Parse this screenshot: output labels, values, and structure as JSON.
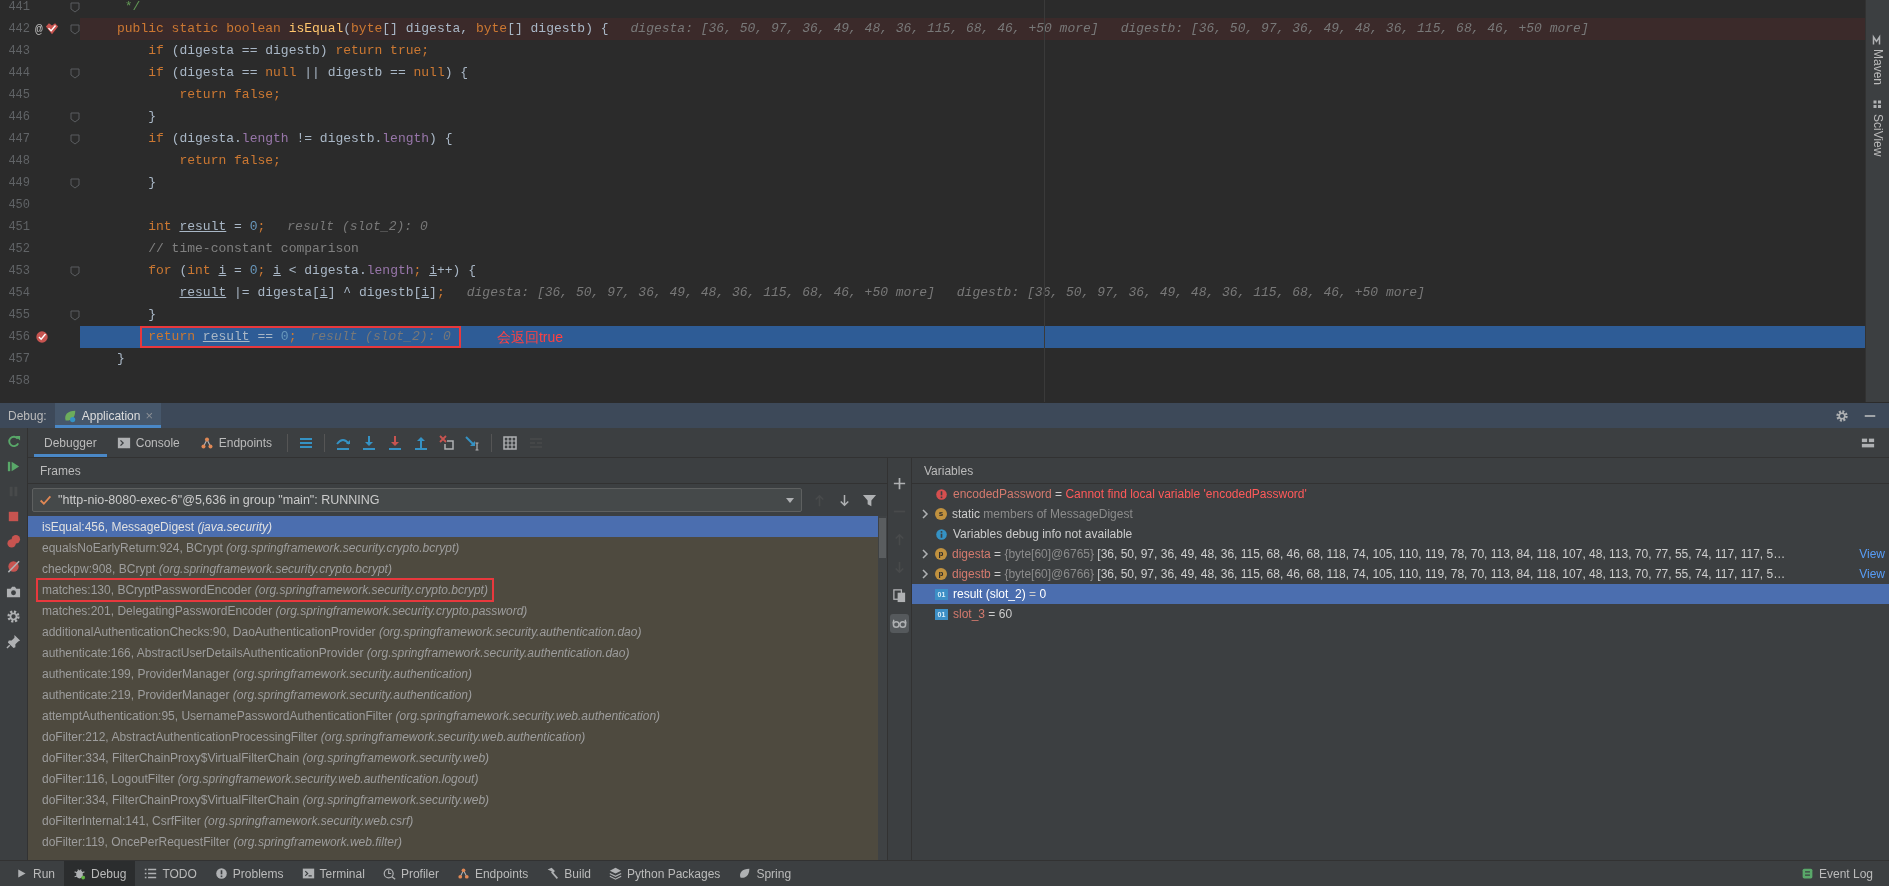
{
  "editor": {
    "lines": [
      {
        "kind": "code",
        "number": "441",
        "fold": true,
        "tokens": [
          {
            "kind": "doc",
            "text": " */"
          }
        ]
      },
      {
        "kind": "breakpoint",
        "number": "442",
        "gutter_symbol": "@",
        "fold": true,
        "tokens": [
          {
            "kind": "kw",
            "text": "public static boolean "
          },
          {
            "kind": "fn",
            "text": "isEqual"
          },
          {
            "kind": "plain",
            "text": "("
          },
          {
            "kind": "kw",
            "text": "byte"
          },
          {
            "kind": "plain",
            "text": "[] digesta, "
          },
          {
            "kind": "kw",
            "text": "byte"
          },
          {
            "kind": "plain",
            "text": "[] digestb) {"
          }
        ],
        "hints": [
          "digesta: [36, 50, 97, 36, 49, 48, 36, 115, 68, 46, +50 more]",
          "digestb: [36, 50, 97, 36, 49, 48, 36, 115, 68, 46, +50 more]"
        ]
      },
      {
        "kind": "code",
        "number": "443",
        "fold": false,
        "tokens": [
          {
            "kind": "kw",
            "text": "    if"
          },
          {
            "kind": "plain",
            "text": " (digesta == digestb) "
          },
          {
            "kind": "kw",
            "text": "return true;"
          }
        ]
      },
      {
        "kind": "code",
        "number": "444",
        "fold": true,
        "tokens": [
          {
            "kind": "kw",
            "text": "    if"
          },
          {
            "kind": "plain",
            "text": " (digesta == "
          },
          {
            "kind": "kw",
            "text": "null"
          },
          {
            "kind": "plain",
            "text": " || digestb == "
          },
          {
            "kind": "kw",
            "text": "null"
          },
          {
            "kind": "plain",
            "text": ") {"
          }
        ]
      },
      {
        "kind": "code",
        "number": "445",
        "fold": false,
        "tokens": [
          {
            "kind": "kw",
            "text": "        return false;"
          }
        ]
      },
      {
        "kind": "code",
        "number": "446",
        "fold": true,
        "tokens": [
          {
            "kind": "plain",
            "text": "    }"
          }
        ]
      },
      {
        "kind": "code",
        "number": "447",
        "fold": true,
        "tokens": [
          {
            "kind": "kw",
            "text": "    if"
          },
          {
            "kind": "plain",
            "text": " (digesta."
          },
          {
            "kind": "field",
            "text": "length"
          },
          {
            "kind": "plain",
            "text": " != digestb."
          },
          {
            "kind": "field",
            "text": "length"
          },
          {
            "kind": "plain",
            "text": ") {"
          }
        ]
      },
      {
        "kind": "code",
        "number": "448",
        "fold": false,
        "tokens": [
          {
            "kind": "kw",
            "text": "        return false;"
          }
        ]
      },
      {
        "kind": "code",
        "number": "449",
        "fold": true,
        "tokens": [
          {
            "kind": "plain",
            "text": "    }"
          }
        ]
      },
      {
        "kind": "code",
        "number": "450",
        "fold": false
      },
      {
        "kind": "code",
        "number": "451",
        "fold": false,
        "tokens": [
          {
            "kind": "kw",
            "text": "    int "
          },
          {
            "kind": "var",
            "text": "result"
          },
          {
            "kind": "plain",
            "text": " = "
          },
          {
            "kind": "num",
            "text": "0"
          },
          {
            "kind": "kw",
            "text": ";"
          }
        ],
        "hints": [
          "result (slot_2): 0"
        ]
      },
      {
        "kind": "code",
        "number": "452",
        "fold": false,
        "tokens": [
          {
            "kind": "comment",
            "text": "    // time-constant comparison"
          }
        ]
      },
      {
        "kind": "code",
        "number": "453",
        "fold": true,
        "tokens": [
          {
            "kind": "kw",
            "text": "    for"
          },
          {
            "kind": "plain",
            "text": " ("
          },
          {
            "kind": "kw",
            "text": "int "
          },
          {
            "kind": "var",
            "text": "i"
          },
          {
            "kind": "plain",
            "text": " = "
          },
          {
            "kind": "num",
            "text": "0"
          },
          {
            "kind": "kw",
            "text": "; "
          },
          {
            "kind": "var",
            "text": "i"
          },
          {
            "kind": "plain",
            "text": " < digesta."
          },
          {
            "kind": "field",
            "text": "length"
          },
          {
            "kind": "kw",
            "text": "; "
          },
          {
            "kind": "var",
            "text": "i"
          },
          {
            "kind": "plain",
            "text": "++) {"
          }
        ]
      },
      {
        "kind": "code",
        "number": "454",
        "fold": false,
        "tokens": [
          {
            "kind": "var",
            "text": "        result"
          },
          {
            "kind": "plain",
            "text": " |= digesta["
          },
          {
            "kind": "var",
            "text": "i"
          },
          {
            "kind": "plain",
            "text": "] ^ digestb["
          },
          {
            "kind": "var",
            "text": "i"
          },
          {
            "kind": "plain",
            "text": "]"
          },
          {
            "kind": "kw",
            "text": ";"
          }
        ],
        "hints": [
          "digesta: [36, 50, 97, 36, 49, 48, 36, 115, 68, 46, +50 more]",
          "digestb: [36, 50, 97, 36, 49, 48, 36, 115, 68, 46, +50 more]"
        ]
      },
      {
        "kind": "code",
        "number": "455",
        "fold": true,
        "tokens": [
          {
            "kind": "plain",
            "text": "    }"
          }
        ]
      },
      {
        "kind": "execution",
        "number": "456",
        "fold": false,
        "boxed": true,
        "tokens": [
          {
            "kind": "kw",
            "text": "    return "
          },
          {
            "kind": "var",
            "text": "result"
          },
          {
            "kind": "plain",
            "text": " == "
          },
          {
            "kind": "num",
            "text": "0"
          },
          {
            "kind": "kw",
            "text": ";"
          }
        ],
        "hints": [
          "result (slot_2): 0"
        ],
        "note": "会返回true"
      },
      {
        "kind": "code",
        "number": "457",
        "fold": false,
        "tokens": [
          {
            "kind": "plain",
            "text": "}"
          }
        ]
      },
      {
        "kind": "code",
        "number": "458",
        "fold": false
      }
    ]
  },
  "right_stripe": [
    {
      "kind": "maven",
      "label": "Maven"
    },
    {
      "kind": "sciview",
      "label": "SciView"
    }
  ],
  "debug": {
    "label": "Debug:",
    "sessions": [
      {
        "label": "Application",
        "close": "×",
        "selected": true
      }
    ],
    "tabs": [
      {
        "kind": "debugger",
        "label": "Debugger",
        "selected": true
      },
      {
        "kind": "console",
        "label": "Console",
        "selected": false
      },
      {
        "kind": "endpoints",
        "label": "Endpoints",
        "selected": false
      }
    ],
    "toolbar": [
      {
        "kind": "menu",
        "disabled": false
      },
      {
        "kind": "stepover",
        "disabled": false
      },
      {
        "kind": "stepinto",
        "disabled": false
      },
      {
        "kind": "forcestepinto",
        "disabled": false
      },
      {
        "kind": "stepout",
        "disabled": false
      },
      {
        "kind": "dropframe",
        "disabled": false
      },
      {
        "kind": "runtocursor",
        "disabled": false
      },
      {
        "kind": "evaluate",
        "disabled": false
      },
      {
        "kind": "trace",
        "disabled": true
      }
    ],
    "side_toolbar": [
      {
        "kind": "rerun",
        "disabled": false
      },
      {
        "kind": "resume",
        "disabled": false
      },
      {
        "kind": "pause",
        "disabled": true
      },
      {
        "kind": "stop",
        "disabled": false
      },
      {
        "kind": "breakpoints",
        "disabled": false
      },
      {
        "kind": "mute",
        "disabled": false
      },
      {
        "kind": "camera",
        "disabled": false
      },
      {
        "kind": "settings",
        "disabled": false
      },
      {
        "kind": "pin",
        "disabled": false
      }
    ],
    "frames": {
      "title": "Frames",
      "thread": "\"http-nio-8080-exec-6\"@5,636 in group \"main\": RUNNING",
      "nav": [
        {
          "kind": "up",
          "disabled": true
        },
        {
          "kind": "down",
          "disabled": false
        },
        {
          "kind": "filter",
          "disabled": false
        }
      ],
      "items": [
        {
          "method": "isEqual:456, MessageDigest",
          "package": "(java.security)",
          "selected": true,
          "boxed": false
        },
        {
          "method": "equalsNoEarlyReturn:924, BCrypt",
          "package": "(org.springframework.security.crypto.bcrypt)",
          "selected": false,
          "boxed": false
        },
        {
          "method": "checkpw:908, BCrypt",
          "package": "(org.springframework.security.crypto.bcrypt)",
          "selected": false,
          "boxed": false
        },
        {
          "method": "matches:130, BCryptPasswordEncoder",
          "package": "(org.springframework.security.crypto.bcrypt)",
          "selected": false,
          "boxed": true
        },
        {
          "method": "matches:201, DelegatingPasswordEncoder",
          "package": "(org.springframework.security.crypto.password)",
          "selected": false,
          "boxed": false
        },
        {
          "method": "additionalAuthenticationChecks:90, DaoAuthenticationProvider",
          "package": "(org.springframework.security.authentication.dao)",
          "selected": false,
          "boxed": false
        },
        {
          "method": "authenticate:166, AbstractUserDetailsAuthenticationProvider",
          "package": "(org.springframework.security.authentication.dao)",
          "selected": false,
          "boxed": false
        },
        {
          "method": "authenticate:199, ProviderManager",
          "package": "(org.springframework.security.authentication)",
          "selected": false,
          "boxed": false
        },
        {
          "method": "authenticate:219, ProviderManager",
          "package": "(org.springframework.security.authentication)",
          "selected": false,
          "boxed": false
        },
        {
          "method": "attemptAuthentication:95, UsernamePasswordAuthenticationFilter",
          "package": "(org.springframework.security.web.authentication)",
          "selected": false,
          "boxed": false
        },
        {
          "method": "doFilter:212, AbstractAuthenticationProcessingFilter",
          "package": "(org.springframework.security.web.authentication)",
          "selected": false,
          "boxed": false
        },
        {
          "method": "doFilter:334, FilterChainProxy$VirtualFilterChain",
          "package": "(org.springframework.security.web)",
          "selected": false,
          "boxed": false
        },
        {
          "method": "doFilter:116, LogoutFilter",
          "package": "(org.springframework.security.web.authentication.logout)",
          "selected": false,
          "boxed": false
        },
        {
          "method": "doFilter:334, FilterChainProxy$VirtualFilterChain",
          "package": "(org.springframework.security.web)",
          "selected": false,
          "boxed": false
        },
        {
          "method": "doFilterInternal:141, CsrfFilter",
          "package": "(org.springframework.security.web.csrf)",
          "selected": false,
          "boxed": false
        },
        {
          "method": "doFilter:119, OncePerRequestFilter",
          "package": "(org.springframework.web.filter)",
          "selected": false,
          "boxed": false
        }
      ]
    },
    "variables_toolbar": [
      {
        "kind": "add",
        "disabled": false
      },
      {
        "kind": "remove",
        "disabled": true
      },
      {
        "kind": "up",
        "disabled": true
      },
      {
        "kind": "down",
        "disabled": true
      },
      {
        "kind": "copy",
        "disabled": false
      },
      {
        "kind": "watches",
        "disabled": false
      }
    ],
    "variables": {
      "title": "Variables",
      "items": [
        {
          "kind": "error",
          "name": "encodedPassword",
          "operator": "=",
          "value": "Cannot find local variable 'encodedPassword'",
          "selected": false
        },
        {
          "kind": "static",
          "icon_letter": "s",
          "expanded": false,
          "name": "static",
          "detail": "members of MessageDigest",
          "selected": false
        },
        {
          "kind": "info",
          "name": "Variables debug info not available",
          "selected": false
        },
        {
          "kind": "param",
          "icon_letter": "p",
          "expanded": false,
          "name": "digesta",
          "operator": "=",
          "type": "{byte[60]@6765}",
          "value": "[36, 50, 97, 36, 49, 48, 36, 115, 68, 46, 68, 118, 74, 105, 110, 119, 78, 70, 113, 84, 118, 107, 48, 113, 70, 77, 55, 74, 117, 117, 5…",
          "link": "View",
          "selected": false
        },
        {
          "kind": "param",
          "icon_letter": "p",
          "expanded": false,
          "name": "digestb",
          "operator": "=",
          "type": "{byte[60]@6766}",
          "value": "[36, 50, 97, 36, 49, 48, 36, 115, 68, 46, 68, 118, 74, 105, 110, 119, 78, 70, 113, 84, 118, 107, 48, 113, 70, 77, 55, 74, 117, 117, 5…",
          "link": "View",
          "selected": false
        },
        {
          "kind": "local",
          "icon_letter": "01",
          "name": "result (slot_2)",
          "operator": "=",
          "value": "0",
          "selected": true
        },
        {
          "kind": "local",
          "icon_letter": "01",
          "name": "slot_3",
          "operator": "=",
          "value": "60",
          "selected": false
        }
      ]
    }
  },
  "bottom_bar": {
    "tools": [
      {
        "kind": "run",
        "label": "Run",
        "selected": false
      },
      {
        "kind": "debug",
        "label": "Debug",
        "selected": true
      },
      {
        "kind": "todo",
        "label": "TODO",
        "selected": false
      },
      {
        "kind": "problems",
        "label": "Problems",
        "selected": false
      },
      {
        "kind": "terminal",
        "label": "Terminal",
        "selected": false
      },
      {
        "kind": "profiler",
        "label": "Profiler",
        "selected": false
      },
      {
        "kind": "endpoints",
        "label": "Endpoints",
        "selected": false
      },
      {
        "kind": "build",
        "label": "Build",
        "selected": false
      },
      {
        "kind": "packages",
        "label": "Python Packages",
        "selected": false
      },
      {
        "kind": "spring",
        "label": "Spring",
        "selected": false
      }
    ],
    "right": {
      "kind": "eventlog",
      "label": "Event Log"
    }
  }
}
